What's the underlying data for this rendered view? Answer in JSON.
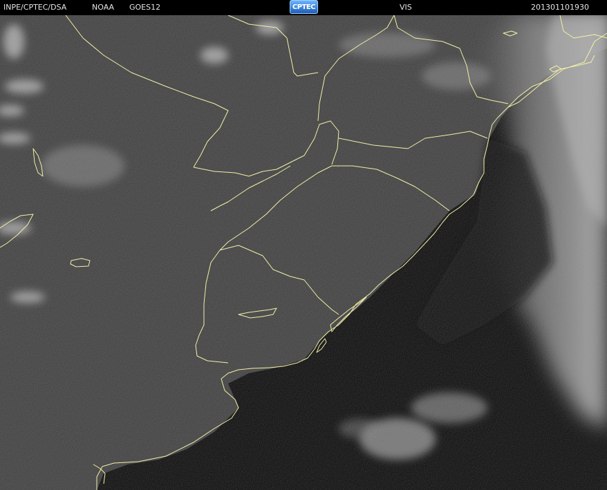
{
  "header": {
    "source": "INPE/CPTEC/DSA",
    "agency": "NOAA",
    "satellite": "GOES12",
    "channel": "VIS",
    "timestamp": "201301101930",
    "logo_text": "CPTEC"
  },
  "map": {
    "type": "satellite visible imagery",
    "border_color": "#f2f0a8",
    "land_color": "#3a3a3a",
    "ocean_color": "#050505",
    "cloud_color": "#cfcfcf"
  }
}
